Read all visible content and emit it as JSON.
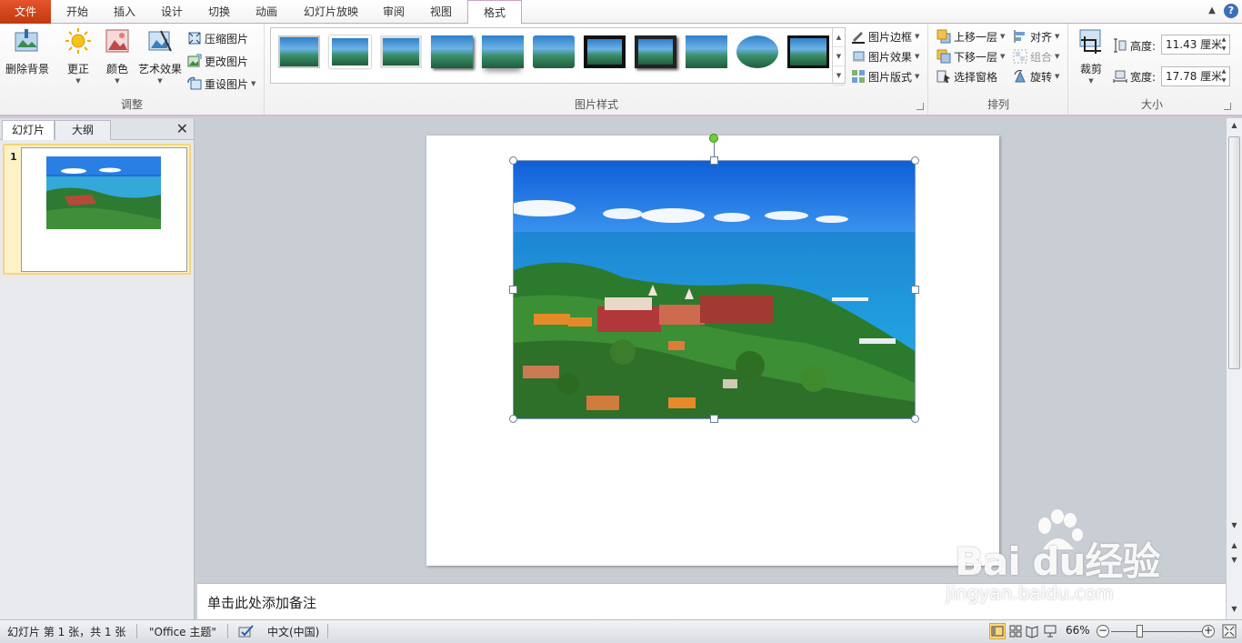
{
  "tabs": [
    {
      "label": "文件"
    },
    {
      "label": "开始"
    },
    {
      "label": "插入"
    },
    {
      "label": "设计"
    },
    {
      "label": "切换"
    },
    {
      "label": "动画"
    },
    {
      "label": "幻灯片放映"
    },
    {
      "label": "审阅"
    },
    {
      "label": "视图"
    },
    {
      "label": "格式"
    }
  ],
  "ribbon": {
    "adjust": {
      "label": "调整",
      "remove_bg": "删除背景",
      "corrections": "更正",
      "color": "颜色",
      "artistic": "艺术效果",
      "compress": "压缩图片",
      "change": "更改图片",
      "reset": "重设图片"
    },
    "styles": {
      "label": "图片样式",
      "border": "图片边框",
      "effects": "图片效果",
      "layout": "图片版式"
    },
    "arrange": {
      "label": "排列",
      "bring_forward": "上移一层",
      "send_backward": "下移一层",
      "selection_pane": "选择窗格",
      "align": "对齐",
      "group": "组合",
      "rotate": "旋转"
    },
    "size": {
      "label": "大小",
      "crop": "裁剪",
      "height_label": "高度:",
      "height_value": "11.43 厘米",
      "width_label": "宽度:",
      "width_value": "17.78 厘米"
    }
  },
  "left_pane": {
    "tab_slides": "幻灯片",
    "tab_outline": "大纲",
    "slide_number": "1"
  },
  "notes": {
    "placeholder": "单击此处添加备注"
  },
  "status": {
    "slide_info": "幻灯片 第 1 张，共 1 张",
    "theme": "\"Office 主题\"",
    "language": "中文(中国)",
    "zoom": "66%"
  },
  "watermark": {
    "brand": "Bai du经验",
    "site": "jingyan.baidu.com"
  },
  "colors": {
    "file_tab": "#c13a10",
    "accent_border": "#c8a4c2",
    "selection_highlight": "#fbd77c",
    "rotate_handle": "#6ad03a"
  }
}
